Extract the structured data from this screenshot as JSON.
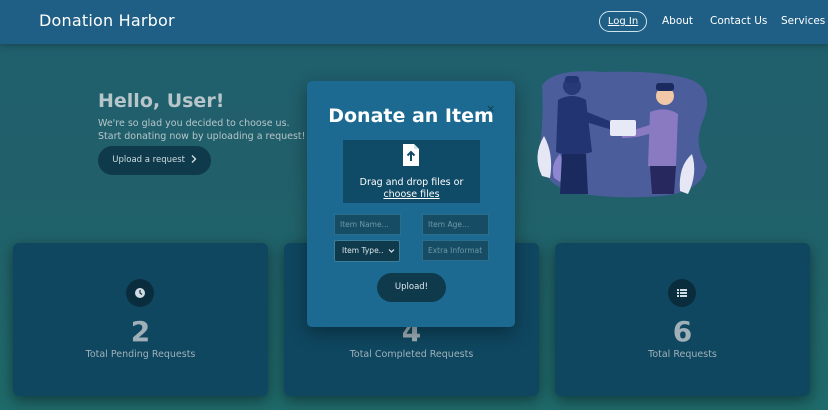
{
  "nav": {
    "brand": "Donation Harbor",
    "login": "Log In",
    "about": "About",
    "contact": "Contact Us",
    "services": "Services"
  },
  "hero": {
    "title": "Hello, User!",
    "subtitle_line1": "We're so glad you decided to choose us.",
    "subtitle_line2": "Start donating now by uploading a request!",
    "button": "Upload a request",
    "button_icon": "chevron-right-icon"
  },
  "modal": {
    "title": "Donate an Item",
    "close": "×",
    "drop_text": "Drag and drop files or",
    "choose_files": "choose files",
    "item_name_placeholder": "Item Name...",
    "item_age_placeholder": "Item Age...",
    "item_type_label": "Item Type..",
    "extra_info_placeholder": "Extra Informat",
    "upload": "Upload!"
  },
  "cards": [
    {
      "value": "2",
      "label": "Total Pending Requests",
      "icon": "clock-icon"
    },
    {
      "value": "4",
      "label": "Total Completed Requests",
      "icon": "check-icon"
    },
    {
      "value": "6",
      "label": "Total Requests",
      "icon": "list-icon"
    }
  ],
  "colors": {
    "navbar": "#1f5f86",
    "background": "#1f5f6e",
    "card": "#0f4760",
    "modal": "#1c6a92",
    "button": "#0f3a4c"
  }
}
